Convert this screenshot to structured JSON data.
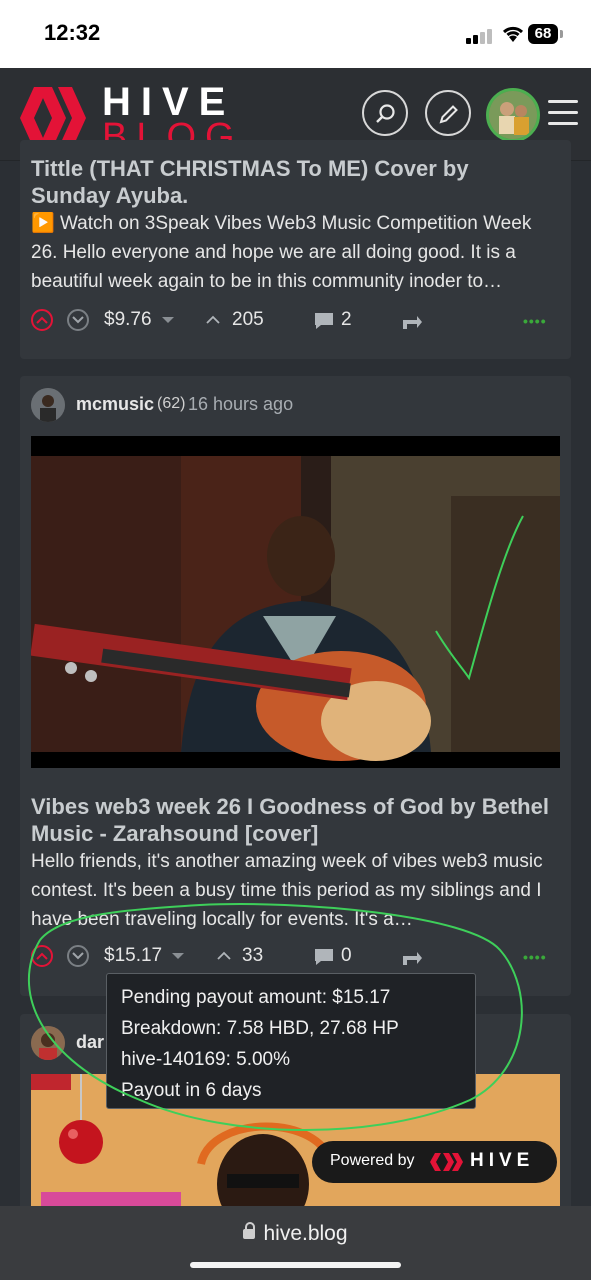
{
  "status_bar": {
    "time": "12:32",
    "battery": "68"
  },
  "header": {
    "brand_top": "HIVE",
    "brand_bottom": "BLOG",
    "brand_color": "#e31337"
  },
  "posts": [
    {
      "title": "Tittle (THAT CHRISTMAS To ME) Cover by Sunday Ayuba.",
      "body_prefix": "▶️",
      "body": "Watch on 3Speak Vibes Web3 Music Competition Week 26. Hello everyone and hope we are all doing good. It is a beautiful week again to be in this community inoder to…",
      "payout": "$9.76",
      "votes": "205",
      "comments": "2"
    },
    {
      "author": "mcmusic",
      "reputation": "(62)",
      "time_ago": "16 hours ago",
      "title": "Vibes web3 week 26 I Goodness of God by Bethel Music - Zarahsound [cover]",
      "body": "Hello friends, it's another amazing week of vibes web3 music contest. It's been a busy time this period as my siblings and I have been traveling locally for events. It's a…",
      "payout": "$15.17",
      "votes": "33",
      "comments": "0"
    },
    {
      "author": "dar"
    }
  ],
  "tooltip": {
    "line1": "Pending payout amount: $15.17",
    "line2": "Breakdown: 7.58 HBD, 27.68 HP",
    "line3": "hive-140169: 5.00%",
    "line4": "Payout in 6 days"
  },
  "powered_badge": {
    "prefix": "Powered by",
    "brand": "HIVE"
  },
  "browser": {
    "url": "hive.blog"
  }
}
